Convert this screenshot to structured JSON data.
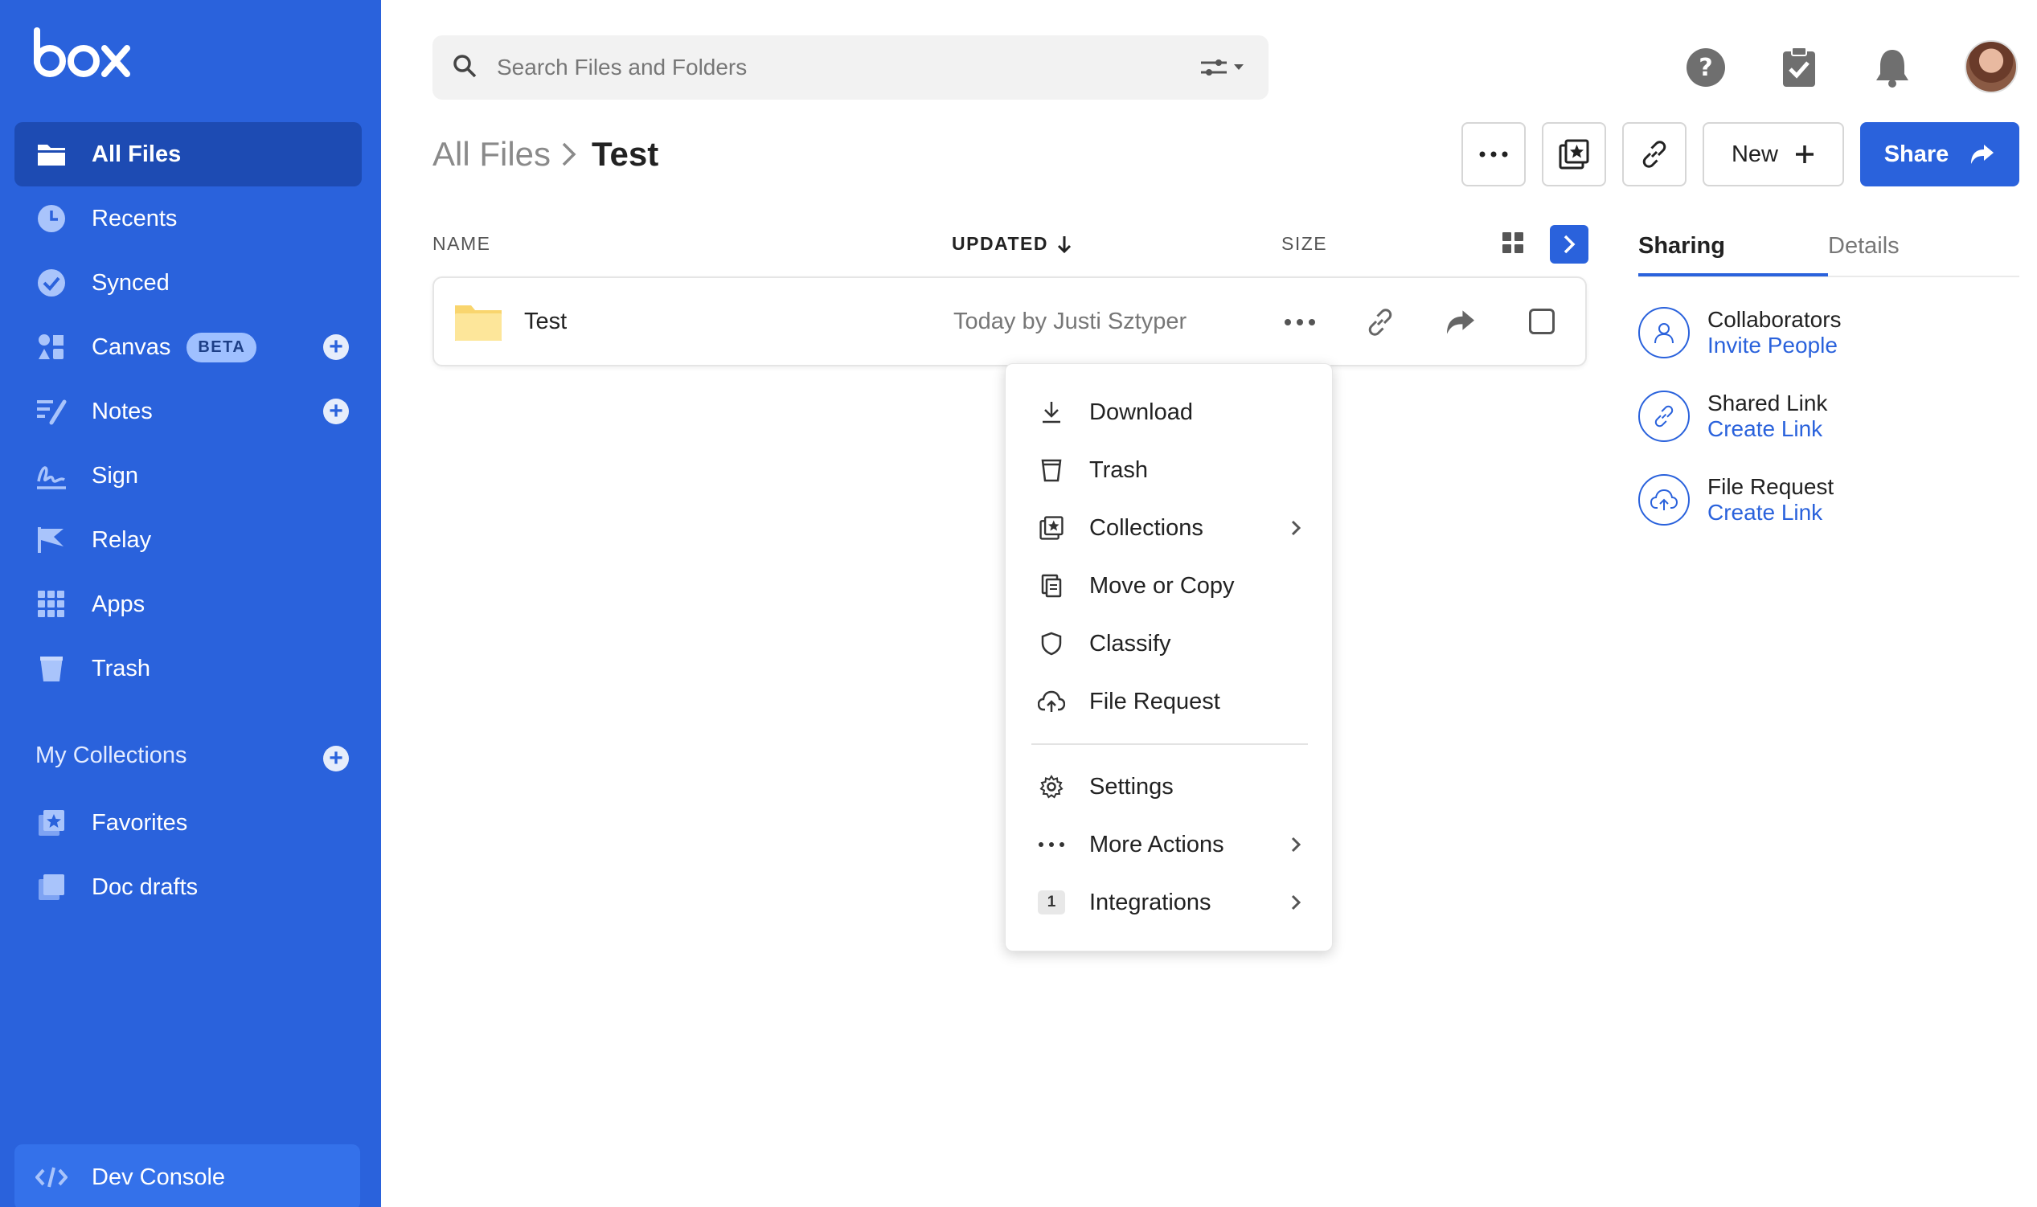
{
  "app": {
    "logo_text": "box"
  },
  "sidebar": {
    "items": [
      {
        "label": "All Files",
        "icon": "folder-icon"
      },
      {
        "label": "Recents",
        "icon": "clock-icon"
      },
      {
        "label": "Synced",
        "icon": "check-circle-icon"
      },
      {
        "label": "Canvas",
        "icon": "canvas-icon",
        "badge": "BETA"
      },
      {
        "label": "Notes",
        "icon": "notes-icon"
      },
      {
        "label": "Sign",
        "icon": "sign-icon"
      },
      {
        "label": "Relay",
        "icon": "relay-icon"
      },
      {
        "label": "Apps",
        "icon": "apps-grid-icon"
      },
      {
        "label": "Trash",
        "icon": "trash-icon"
      }
    ],
    "collections_title": "My Collections",
    "collections": [
      {
        "label": "Favorites",
        "icon": "star-collection-icon"
      },
      {
        "label": "Doc drafts",
        "icon": "collection-icon"
      }
    ],
    "dev_console": "Dev Console"
  },
  "search": {
    "placeholder": "Search Files and Folders"
  },
  "breadcrumb": {
    "root": "All Files",
    "current": "Test"
  },
  "toolbar": {
    "new_label": "New",
    "share_label": "Share"
  },
  "table": {
    "headers": {
      "name": "NAME",
      "updated": "UPDATED",
      "size": "SIZE"
    },
    "rows": [
      {
        "name": "Test",
        "updated": "Today by Justi Sztyper"
      }
    ]
  },
  "menu": {
    "items": [
      {
        "label": "Download",
        "icon": "download-icon"
      },
      {
        "label": "Trash",
        "icon": "trash-icon"
      },
      {
        "label": "Collections",
        "icon": "collection-icon"
      },
      {
        "label": "Move or Copy",
        "icon": "copy-icon"
      },
      {
        "label": "Classify",
        "icon": "shield-icon"
      },
      {
        "label": "File Request",
        "icon": "cloud-upload-icon"
      },
      {
        "label": "Settings",
        "icon": "gear-icon"
      },
      {
        "label": "More Actions",
        "icon": "ellipsis-icon"
      },
      {
        "label": "Integrations",
        "icon": "integrations-badge",
        "badge": "1"
      }
    ]
  },
  "panel": {
    "tabs": [
      "Sharing",
      "Details"
    ],
    "items": [
      {
        "title": "Collaborators",
        "link": "Invite People",
        "icon": "user-icon"
      },
      {
        "title": "Shared Link",
        "link": "Create Link",
        "icon": "link-icon"
      },
      {
        "title": "File Request",
        "link": "Create Link",
        "icon": "cloud-upload-icon"
      }
    ]
  },
  "colors": {
    "brand": "#2a62dc",
    "sidebar_active": "#1d4bb3",
    "dev_console": "#3471ea"
  }
}
